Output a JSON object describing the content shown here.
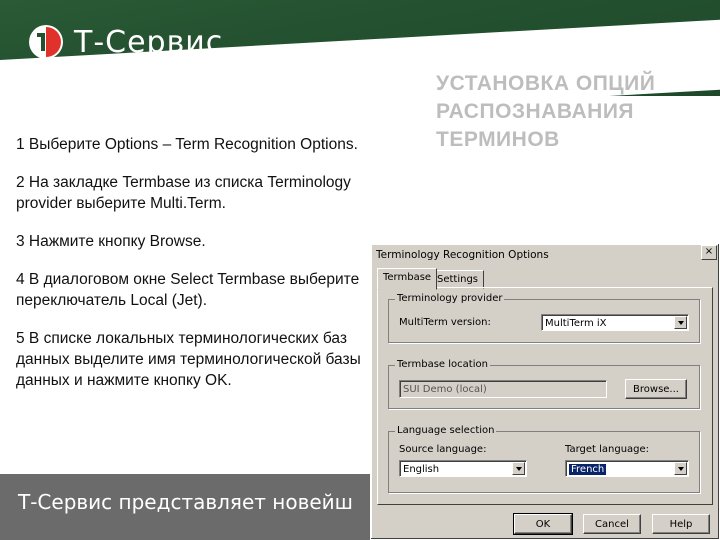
{
  "brand": {
    "name": "Т-Сервис"
  },
  "slide": {
    "title_lines": [
      "УСТАНОВКА ОПЦИЙ",
      "РАСПОЗНАВАНИЯ",
      "ТЕРМИНОВ"
    ],
    "steps": [
      "1 Выберите Options – Term Recognition Options.",
      "2 На закладке Termbase из списка Terminology provider выберите Multi.Term.",
      "3 Нажмите кнопку Browse.",
      "4 В диалоговом окне Select Termbase выберите переключатель Local (Jet).",
      "5 В списке локальных терминологических баз данных выделите имя терминологической базы данных и нажмите кнопку OK."
    ],
    "footer": "Т-Сервис представляет новейш"
  },
  "dialog": {
    "title": "Terminology Recognition Options",
    "close": "×",
    "tabs": [
      "Termbase",
      "Settings"
    ],
    "provider_group": "Terminology provider",
    "multiterm_label": "MultiTerm version:",
    "multiterm_value": "MultiTerm iX",
    "location_group": "Termbase location",
    "location_value": "SUI Demo (local)",
    "browse": "Browse...",
    "language_group": "Language selection",
    "source_label": "Source language:",
    "source_value": "English",
    "target_label": "Target language:",
    "target_value": "French",
    "ok": "OK",
    "cancel": "Cancel",
    "help": "Help"
  },
  "colors": {
    "header_green": "#23502f",
    "title_gray": "#bdbdbd",
    "footer_gray": "#6b6b6b",
    "dialog_face": "#d4d0c8",
    "selection": "#0a246a",
    "logo_red": "#e0312b"
  }
}
